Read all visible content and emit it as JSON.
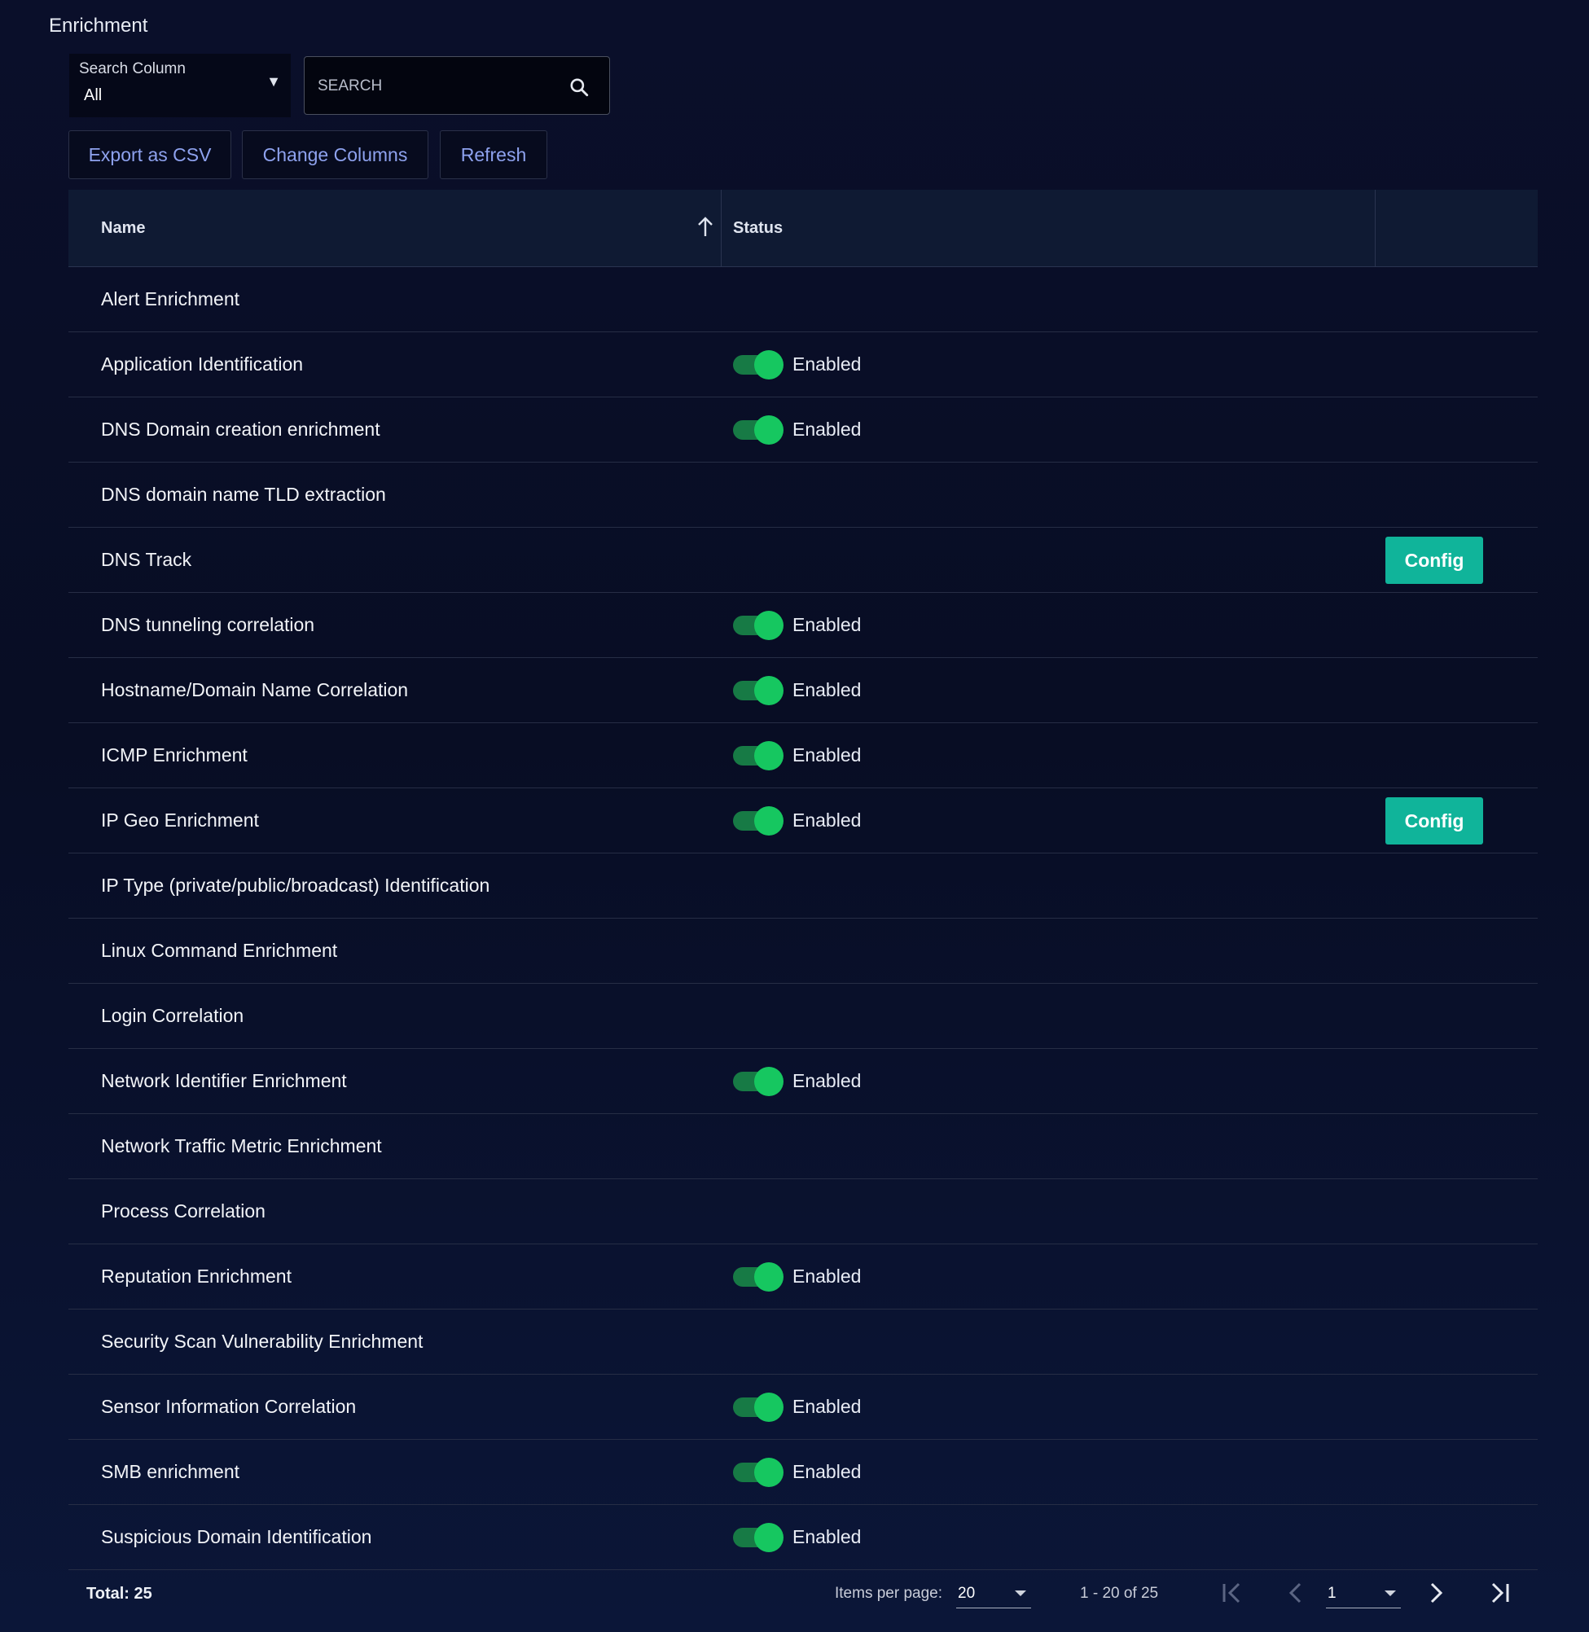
{
  "page": {
    "title": "Enrichment"
  },
  "search": {
    "column_label": "Search Column",
    "column_value": "All",
    "placeholder": "SEARCH"
  },
  "toolbar": {
    "export_label": "Export as CSV",
    "columns_label": "Change Columns",
    "refresh_label": "Refresh"
  },
  "table": {
    "headers": {
      "name": "Name",
      "status": "Status"
    },
    "sort": {
      "column": "Name",
      "direction": "ascending",
      "icon": "arrow-up-icon"
    },
    "rows": [
      {
        "name": "Alert Enrichment",
        "enabled": false,
        "status": "",
        "config": ""
      },
      {
        "name": "Application Identification",
        "enabled": true,
        "status": "Enabled",
        "config": ""
      },
      {
        "name": "DNS Domain creation enrichment",
        "enabled": true,
        "status": "Enabled",
        "config": ""
      },
      {
        "name": "DNS domain name TLD extraction",
        "enabled": false,
        "status": "",
        "config": ""
      },
      {
        "name": "DNS Track",
        "enabled": false,
        "status": "",
        "config": "Config"
      },
      {
        "name": "DNS tunneling correlation",
        "enabled": true,
        "status": "Enabled",
        "config": ""
      },
      {
        "name": "Hostname/Domain Name Correlation",
        "enabled": true,
        "status": "Enabled",
        "config": ""
      },
      {
        "name": "ICMP Enrichment",
        "enabled": true,
        "status": "Enabled",
        "config": ""
      },
      {
        "name": "IP Geo Enrichment",
        "enabled": true,
        "status": "Enabled",
        "config": "Config"
      },
      {
        "name": "IP Type (private/public/broadcast) Identification",
        "enabled": false,
        "status": "",
        "config": ""
      },
      {
        "name": "Linux Command Enrichment",
        "enabled": false,
        "status": "",
        "config": ""
      },
      {
        "name": "Login Correlation",
        "enabled": false,
        "status": "",
        "config": ""
      },
      {
        "name": "Network Identifier Enrichment",
        "enabled": true,
        "status": "Enabled",
        "config": ""
      },
      {
        "name": "Network Traffic Metric Enrichment",
        "enabled": false,
        "status": "",
        "config": ""
      },
      {
        "name": "Process Correlation",
        "enabled": false,
        "status": "",
        "config": ""
      },
      {
        "name": "Reputation Enrichment",
        "enabled": true,
        "status": "Enabled",
        "config": ""
      },
      {
        "name": "Security Scan Vulnerability Enrichment",
        "enabled": false,
        "status": "",
        "config": ""
      },
      {
        "name": "Sensor Information Correlation",
        "enabled": true,
        "status": "Enabled",
        "config": ""
      },
      {
        "name": "SMB enrichment",
        "enabled": true,
        "status": "Enabled",
        "config": ""
      },
      {
        "name": "Suspicious Domain Identification",
        "enabled": true,
        "status": "Enabled",
        "config": ""
      }
    ]
  },
  "footer": {
    "total_label": "Total: 25",
    "items_per_page_label": "Items per page:",
    "items_per_page_value": "20",
    "range_label": "1 - 20 of 25",
    "page_value": "1"
  },
  "colors": {
    "background": "#080d24",
    "accent_link": "#8ea2ee",
    "toggle_on_knob": "#16c760",
    "toggle_on_track": "#177a45",
    "config_button": "#10b49a"
  }
}
